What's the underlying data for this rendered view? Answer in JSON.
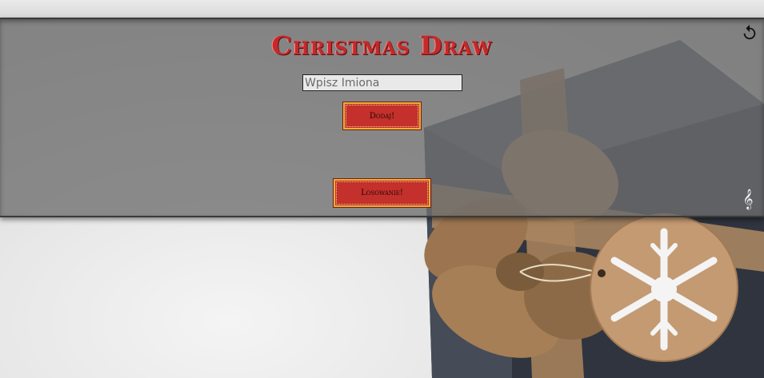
{
  "app": {
    "title": "Christmas Draw"
  },
  "form": {
    "name_placeholder": "Wpisz Imiona",
    "name_value": "",
    "add_label": "Dodaj!",
    "draw_label": "Losowanie!"
  },
  "icons": {
    "reset": "reset-icon",
    "music": "music-icon",
    "music_glyph": "𝄞"
  },
  "colors": {
    "title": "#c62a2a",
    "button_bg": "#c4302b",
    "button_border": "#e8b13a",
    "panel": "#6e6e6e"
  }
}
